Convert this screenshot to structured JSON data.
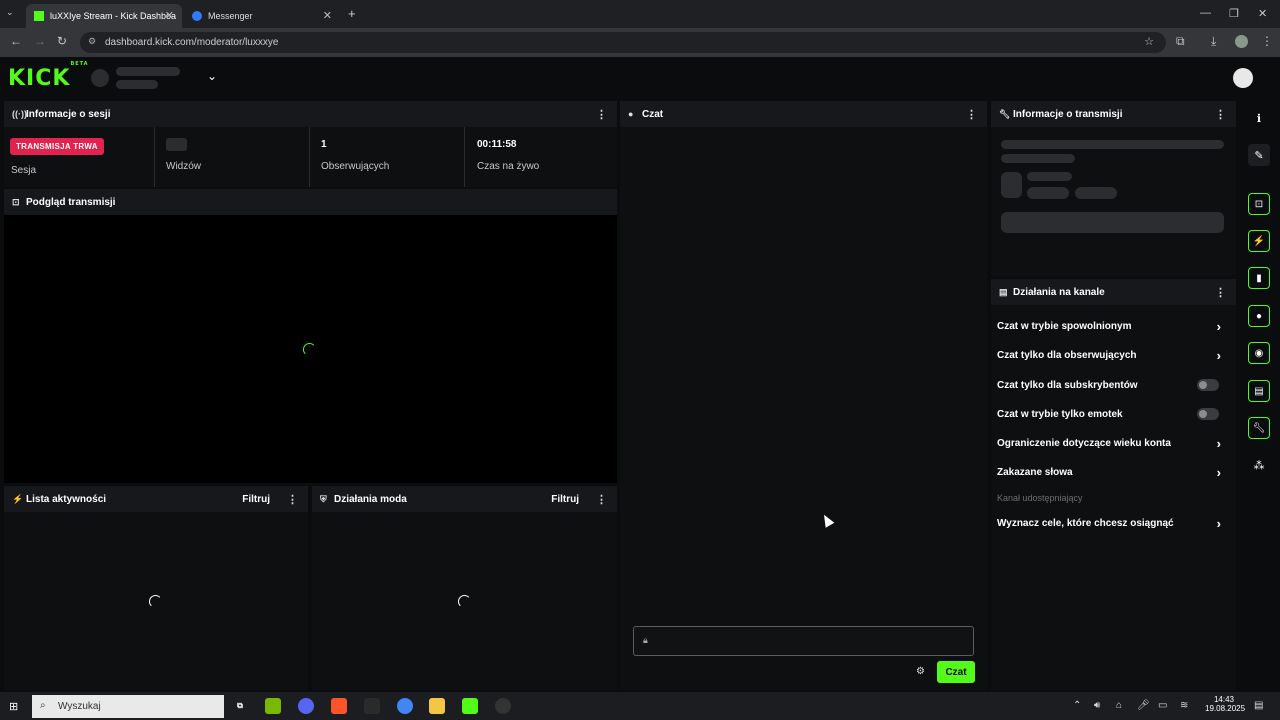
{
  "browser": {
    "tabs": [
      {
        "title": "luXXIye Stream - Kick Dashboa",
        "active": true
      },
      {
        "title": "Messenger",
        "active": false
      }
    ],
    "url": "dashboard.kick.com/moderator/luxxxye"
  },
  "header": {
    "logo": "KICK",
    "logo_tag": "BETA"
  },
  "session": {
    "title": "Informacje o sesji",
    "badge": "TRANSMISJA TRWA",
    "session_label": "Sesja",
    "viewers_label": "Widzów",
    "followers_value": "1",
    "followers_label": "Obserwujących",
    "live_time_value": "00:11:58",
    "live_time_label": "Czas na żywo"
  },
  "preview": {
    "title": "Podgląd transmisji"
  },
  "activity": {
    "title": "Lista aktywności",
    "filter_label": "Filtruj"
  },
  "mod_actions": {
    "title": "Działania moda",
    "filter_label": "Filtruj"
  },
  "chat": {
    "title": "Czat",
    "send_label": "Czat"
  },
  "stream_info": {
    "title": "Informacje o transmisji"
  },
  "channel_actions": {
    "title": "Działania na kanale",
    "items": [
      {
        "label": "Czat w trybie spowolnionym",
        "control": "chevron"
      },
      {
        "label": "Czat tylko dla obserwujących",
        "control": "chevron"
      },
      {
        "label": "Czat tylko dla subskrybentów",
        "control": "toggle",
        "enabled": false
      },
      {
        "label": "Czat w trybie tylko emotek",
        "control": "toggle",
        "enabled": false
      },
      {
        "label": "Ograniczenie dotyczące wieku konta",
        "control": "chevron"
      },
      {
        "label": "Zakazane słowa",
        "control": "chevron"
      }
    ],
    "section_label": "Kanał udostępniający",
    "goals_label": "Wyznacz cele, które chcesz osiągnąć"
  },
  "taskbar": {
    "search_placeholder": "Wyszukaj",
    "time": "14:43",
    "date": "19.08.2025"
  },
  "colors": {
    "accent": "#53fc18",
    "live": "#e1234e"
  }
}
